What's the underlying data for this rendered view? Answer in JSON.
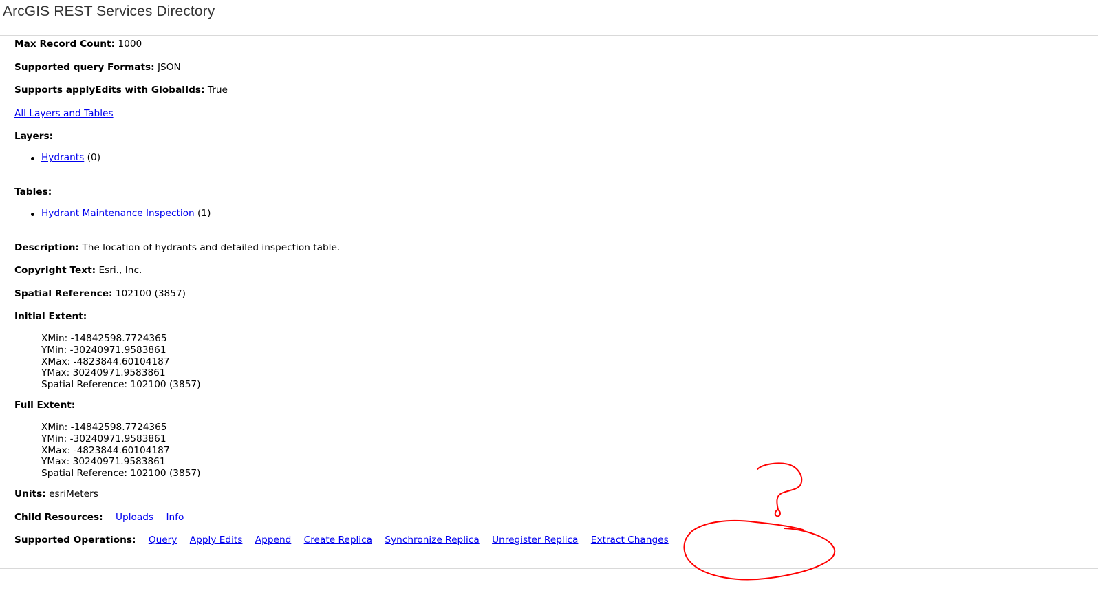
{
  "header": {
    "title": "ArcGIS REST Services Directory"
  },
  "partial_top": {
    "label": "Max Record Count:",
    "value": "1000"
  },
  "query_formats": {
    "label": "Supported query Formats:",
    "value": "JSON"
  },
  "apply_edits_globalids": {
    "label": "Supports applyEdits with GlobalIds:",
    "value": "True"
  },
  "all_layers_link": "All Layers and Tables",
  "layers": {
    "label": "Layers:",
    "items": [
      {
        "name": "Hydrants",
        "id": "(0)"
      }
    ]
  },
  "tables": {
    "label": "Tables:",
    "items": [
      {
        "name": "Hydrant Maintenance Inspection",
        "id": "(1)"
      }
    ]
  },
  "description": {
    "label": "Description:",
    "value": "The location of hydrants and detailed inspection table."
  },
  "copyright": {
    "label": "Copyright Text:",
    "value": "Esri., Inc."
  },
  "spatial_reference": {
    "label": "Spatial Reference:",
    "value": "102100 (3857)"
  },
  "initial_extent": {
    "label": "Initial Extent:",
    "xmin": "XMin: -14842598.7724365",
    "ymin": "YMin: -30240971.9583861",
    "xmax": "XMax: -4823844.60104187",
    "ymax": "YMax: 30240971.9583861",
    "sr": "Spatial Reference: 102100 (3857)"
  },
  "full_extent": {
    "label": "Full Extent:",
    "xmin": "XMin: -14842598.7724365",
    "ymin": "YMin: -30240971.9583861",
    "xmax": "XMax: -4823844.60104187",
    "ymax": "YMax: 30240971.9583861",
    "sr": "Spatial Reference: 102100 (3857)"
  },
  "units": {
    "label": "Units:",
    "value": "esriMeters"
  },
  "child_resources": {
    "label": "Child Resources:",
    "links": [
      "Uploads",
      "Info"
    ]
  },
  "supported_operations": {
    "label": "Supported Operations:",
    "links": [
      "Query",
      "Apply Edits",
      "Append",
      "Create Replica",
      "Synchronize Replica",
      "Unregister Replica",
      "Extract Changes"
    ]
  },
  "annotation": {
    "color": "#ff0000",
    "shape": "hand-drawn question mark and circle"
  }
}
